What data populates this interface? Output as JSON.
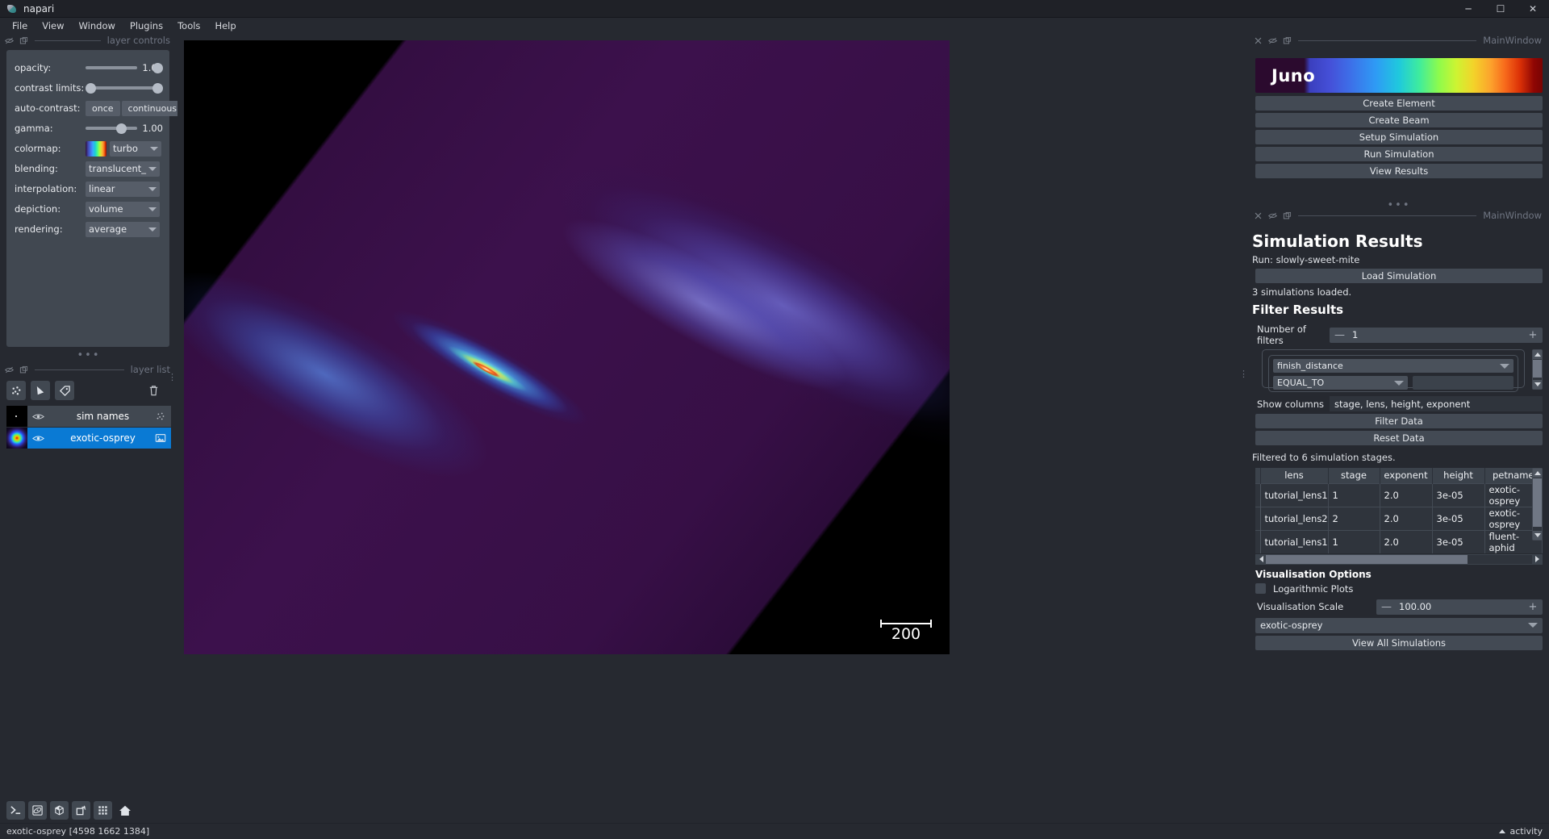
{
  "titlebar": {
    "app": "napari",
    "minimize": "─",
    "maximize": "☐",
    "close": "✕"
  },
  "menubar": {
    "items": [
      "File",
      "View",
      "Window",
      "Plugins",
      "Tools",
      "Help"
    ]
  },
  "left": {
    "dock_title": "layer controls",
    "controls": {
      "opacity": {
        "label": "opacity:",
        "value": "1.00"
      },
      "contrast_limits": {
        "label": "contrast limits:"
      },
      "auto_contrast": {
        "label": "auto-contrast:",
        "once": "once",
        "continuous": "continuous"
      },
      "gamma": {
        "label": "gamma:",
        "value": "1.00"
      },
      "colormap": {
        "label": "colormap:",
        "value": "turbo"
      },
      "blending": {
        "label": "blending:",
        "value": "translucent_"
      },
      "interpolation": {
        "label": "interpolation:",
        "value": "linear"
      },
      "depiction": {
        "label": "depiction:",
        "value": "volume"
      },
      "rendering": {
        "label": "rendering:",
        "value": "average"
      }
    },
    "layerlist": {
      "dock_title": "layer list",
      "buttons": [
        "points-icon",
        "shapes-icon",
        "labels-icon",
        "delete-icon"
      ],
      "layers": [
        {
          "name": "sim names",
          "type": "points",
          "visible": true,
          "selected": false
        },
        {
          "name": "exotic-osprey",
          "type": "image",
          "visible": true,
          "selected": true
        }
      ]
    },
    "viewer_buttons": [
      "console-icon",
      "ndisplay-icon",
      "roll-dims-icon",
      "transpose-icon",
      "grid-icon",
      "home-icon"
    ]
  },
  "canvas": {
    "scalebar_value": "200"
  },
  "right": {
    "panel1": {
      "dock_title": "MainWindow",
      "logo_text": "Juno",
      "buttons": [
        "Create Element",
        "Create Beam",
        "Setup Simulation",
        "Run Simulation",
        "View Results"
      ]
    },
    "panel2": {
      "dock_title": "MainWindow",
      "title": "Simulation Results",
      "run_label": "Run: slowly-sweet-mite",
      "load_button": "Load Simulation",
      "loaded_note": "3 simulations loaded.",
      "filter_heading": "Filter Results",
      "num_filters_label": "Number of filters",
      "num_filters_value": "1",
      "minus": "—",
      "plus": "+",
      "filter_field": "finish_distance",
      "filter_operator": "EQUAL_TO",
      "filter_value": "",
      "show_columns_label": "Show columns",
      "show_columns_value": "stage, lens, height, exponent",
      "filter_data_button": "Filter Data",
      "reset_data_button": "Reset Data",
      "filtered_note": "Filtered to 6 simulation stages.",
      "table": {
        "columns": [
          "lens",
          "stage",
          "exponent",
          "height",
          "petname"
        ],
        "rows": [
          [
            "tutorial_lens1",
            "1",
            "2.0",
            "3e-05",
            "exotic-osprey"
          ],
          [
            "tutorial_lens2",
            "2",
            "2.0",
            "3e-05",
            "exotic-osprey"
          ],
          [
            "tutorial_lens1",
            "1",
            "2.0",
            "3e-05",
            "fluent-aphid"
          ]
        ]
      },
      "viz_heading": "Visualisation Options",
      "log_plots_label": "Logarithmic Plots",
      "viz_scale_label": "Visualisation Scale",
      "viz_scale_value": "100.00",
      "sim_select_value": "exotic-osprey",
      "view_all_button": "View All Simulations"
    }
  },
  "statusbar": {
    "text": "exotic-osprey [4598 1662 1384]",
    "activity": "activity"
  }
}
